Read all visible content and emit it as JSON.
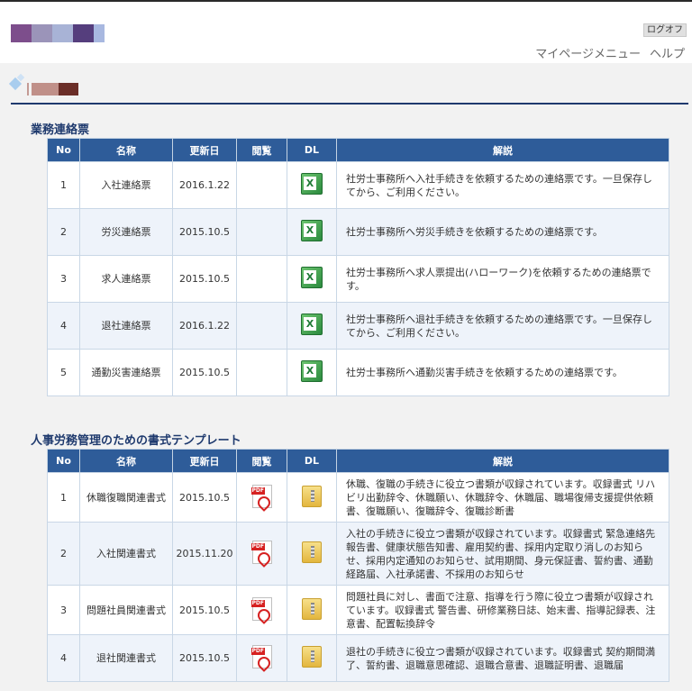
{
  "header": {
    "logo_colors": [
      "#7d4e8c",
      "#9b94b9",
      "#a8b3d6",
      "#553e7d",
      "#a8b8e0"
    ],
    "logout_label": "ログオフ",
    "nav": [
      {
        "label": "マイページメニュー"
      },
      {
        "label": "ヘルプ"
      }
    ]
  },
  "user": {
    "name_colors": [
      "#c49a94",
      "#8a4f4a",
      "#6b2e28"
    ]
  },
  "sections": [
    {
      "title": "業務連絡票",
      "columns": [
        "No",
        "名称",
        "更新日",
        "閲覧",
        "DL",
        "解説"
      ],
      "rows": [
        {
          "no": "1",
          "name": "入社連絡票",
          "date": "2016.1.22",
          "view": "",
          "dl_icon": "excel-icon",
          "desc": "社労士事務所へ入社手続きを依頼するための連絡票です。一旦保存してから、ご利用ください。"
        },
        {
          "no": "2",
          "name": "労災連絡票",
          "date": "2015.10.5",
          "view": "",
          "dl_icon": "excel-icon",
          "desc": "社労士事務所へ労災手続きを依頼するための連絡票です。"
        },
        {
          "no": "3",
          "name": "求人連絡票",
          "date": "2015.10.5",
          "view": "",
          "dl_icon": "excel-icon",
          "desc": "社労士事務所へ求人票提出(ハローワーク)を依頼するための連絡票です。"
        },
        {
          "no": "4",
          "name": "退社連絡票",
          "date": "2016.1.22",
          "view": "",
          "dl_icon": "excel-icon",
          "desc": "社労士事務所へ退社手続きを依頼するための連絡票です。一旦保存してから、ご利用ください。"
        },
        {
          "no": "5",
          "name": "通勤災害連絡票",
          "date": "2015.10.5",
          "view": "",
          "dl_icon": "excel-icon",
          "desc": "社労士事務所へ通勤災害手続きを依頼するための連絡票です。"
        }
      ]
    },
    {
      "title": "人事労務管理のための書式テンプレート",
      "columns": [
        "No",
        "名称",
        "更新日",
        "閲覧",
        "DL",
        "解説"
      ],
      "rows": [
        {
          "no": "1",
          "name": "休職復職関連書式",
          "date": "2015.10.5",
          "view_icon": "pdf-icon",
          "dl_icon": "zip-icon",
          "desc": "休職、復職の手続きに役立つ書類が収録されています。収録書式 リハビリ出勤辞令、休職願い、休職辞令、休職届、職場復帰支援提供依頼書、復職願い、復職辞令、復職診断書"
        },
        {
          "no": "2",
          "name": "入社関連書式",
          "date": "2015.11.20",
          "view_icon": "pdf-icon",
          "dl_icon": "zip-icon",
          "desc": "入社の手続きに役立つ書類が収録されています。収録書式 緊急連絡先報告書、健康状態告知書、雇用契約書、採用内定取り消しのお知らせ、採用内定通知のお知らせ、試用期間、身元保証書、誓約書、通勤経路届、入社承諾書、不採用のお知らせ"
        },
        {
          "no": "3",
          "name": "問題社員関連書式",
          "date": "2015.10.5",
          "view_icon": "pdf-icon",
          "dl_icon": "zip-icon",
          "desc": "問題社員に対し、書面で注意、指導を行う際に役立つ書類が収録されています。収録書式 警告書、研修業務日誌、始末書、指導記録表、注意書、配置転換辞令"
        },
        {
          "no": "4",
          "name": "退社関連書式",
          "date": "2015.10.5",
          "view_icon": "pdf-icon",
          "dl_icon": "zip-icon",
          "desc": "退社の手続きに役立つ書類が収録されています。収録書式 契約期間満了、誓約書、退職意思確認、退職合意書、退職証明書、退職届"
        }
      ]
    }
  ]
}
